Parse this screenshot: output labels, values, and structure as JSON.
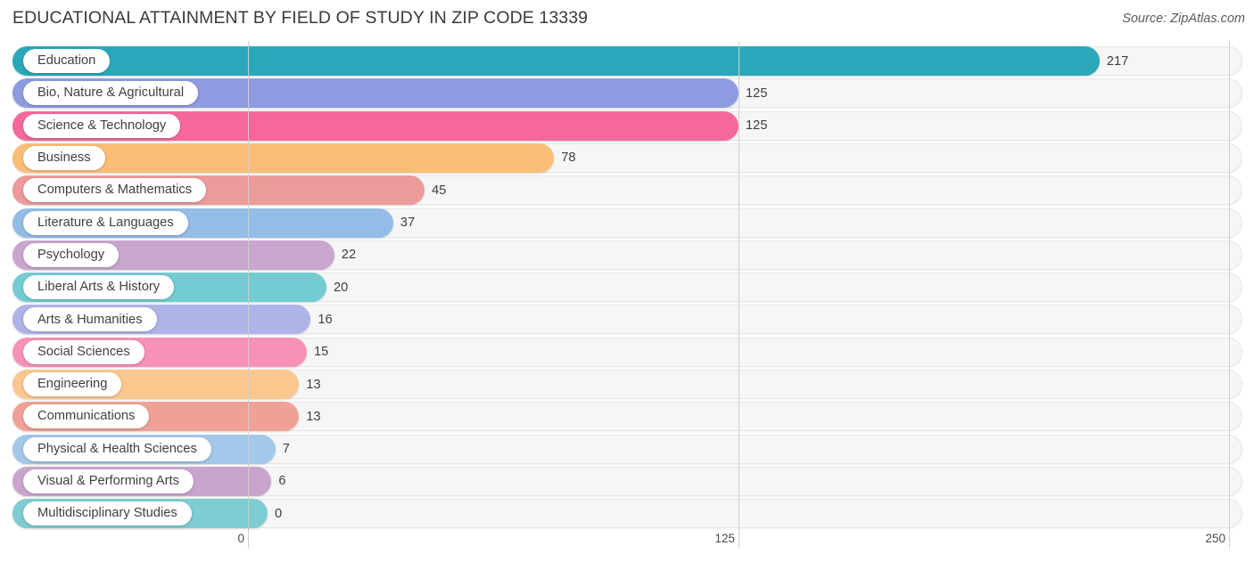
{
  "header": {
    "title": "EDUCATIONAL ATTAINMENT BY FIELD OF STUDY IN ZIP CODE 13339",
    "source": "Source: ZipAtlas.com"
  },
  "chart_data": {
    "type": "bar",
    "orientation": "horizontal",
    "title": "EDUCATIONAL ATTAINMENT BY FIELD OF STUDY IN ZIP CODE 13339",
    "xlabel": "",
    "ylabel": "",
    "xlim": [
      0,
      250
    ],
    "xticks": [
      0,
      125,
      250
    ],
    "xtick_labels": [
      "0",
      "125",
      "250"
    ],
    "grid": true,
    "legend": false,
    "categories": [
      "Education",
      "Bio, Nature & Agricultural",
      "Science & Technology",
      "Business",
      "Computers & Mathematics",
      "Literature & Languages",
      "Psychology",
      "Liberal Arts & History",
      "Arts & Humanities",
      "Social Sciences",
      "Engineering",
      "Communications",
      "Physical & Health Sciences",
      "Visual & Performing Arts",
      "Multidisciplinary Studies"
    ],
    "values": [
      217,
      125,
      125,
      78,
      45,
      37,
      22,
      20,
      16,
      15,
      13,
      13,
      7,
      6,
      0
    ],
    "value_labels": [
      "217",
      "125",
      "125",
      "78",
      "45",
      "37",
      "22",
      "20",
      "16",
      "15",
      "13",
      "13",
      "7",
      "6",
      "0"
    ],
    "colors": [
      "#2AA8BA",
      "#8E9BE0",
      "#F4689D",
      "#FBBE77",
      "#EC9A9A",
      "#93BDE6",
      "#C8A6CE",
      "#74CBD2",
      "#AEB4E8",
      "#F791B8",
      "#FBC78E",
      "#F0A197",
      "#A3C8EA",
      "#C9A5CE",
      "#7ECDD2"
    ]
  }
}
